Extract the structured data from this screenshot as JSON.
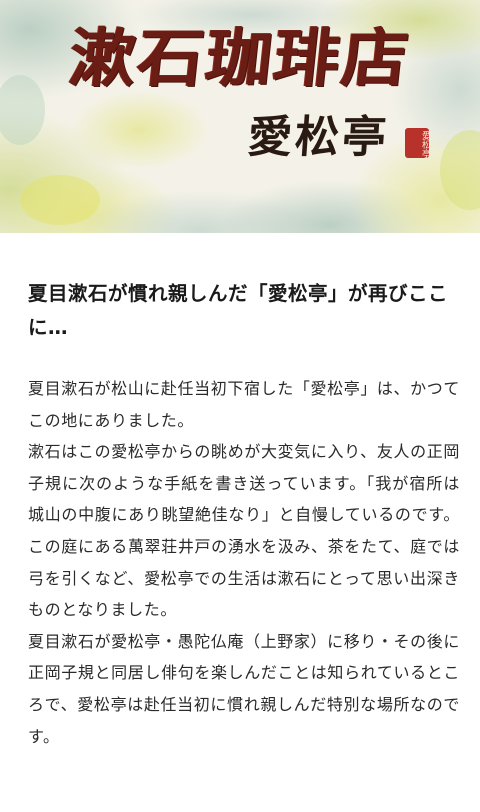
{
  "hero": {
    "title": "漱石珈琲店",
    "subtitle": "愛松亭",
    "seal_text": "愛松亭",
    "colors": {
      "title": "#6a1d14",
      "subtitle": "#2a1a14",
      "seal": "#b8312a",
      "background": "#f3f1e6"
    }
  },
  "article": {
    "headline": "夏目漱石が慣れ親しんだ「愛松亭」が再びここに…",
    "paragraphs": [
      "夏目漱石が松山に赴任当初下宿した「愛松亭」は、かつてこの地にありました。",
      "漱石はこの愛松亭からの眺めが大変気に入り、友人の正岡子規に次のような手紙を書き送っています。「我が宿所は城山の中腹にあり眺望絶佳なり」と自慢しているのです。この庭にある萬翠荘井戸の湧水を汲み、茶をたて、庭では弓を引くなど、愛松亭での生活は漱石にとって思い出深きものとなりました。",
      "夏目漱石が愛松亭・愚陀仏庵（上野家）に移り・その後に正岡子規と同居し俳句を楽しんだことは知られているところで、愛松亭は赴任当初に慣れ親しんだ特別な場所なのです。"
    ]
  }
}
